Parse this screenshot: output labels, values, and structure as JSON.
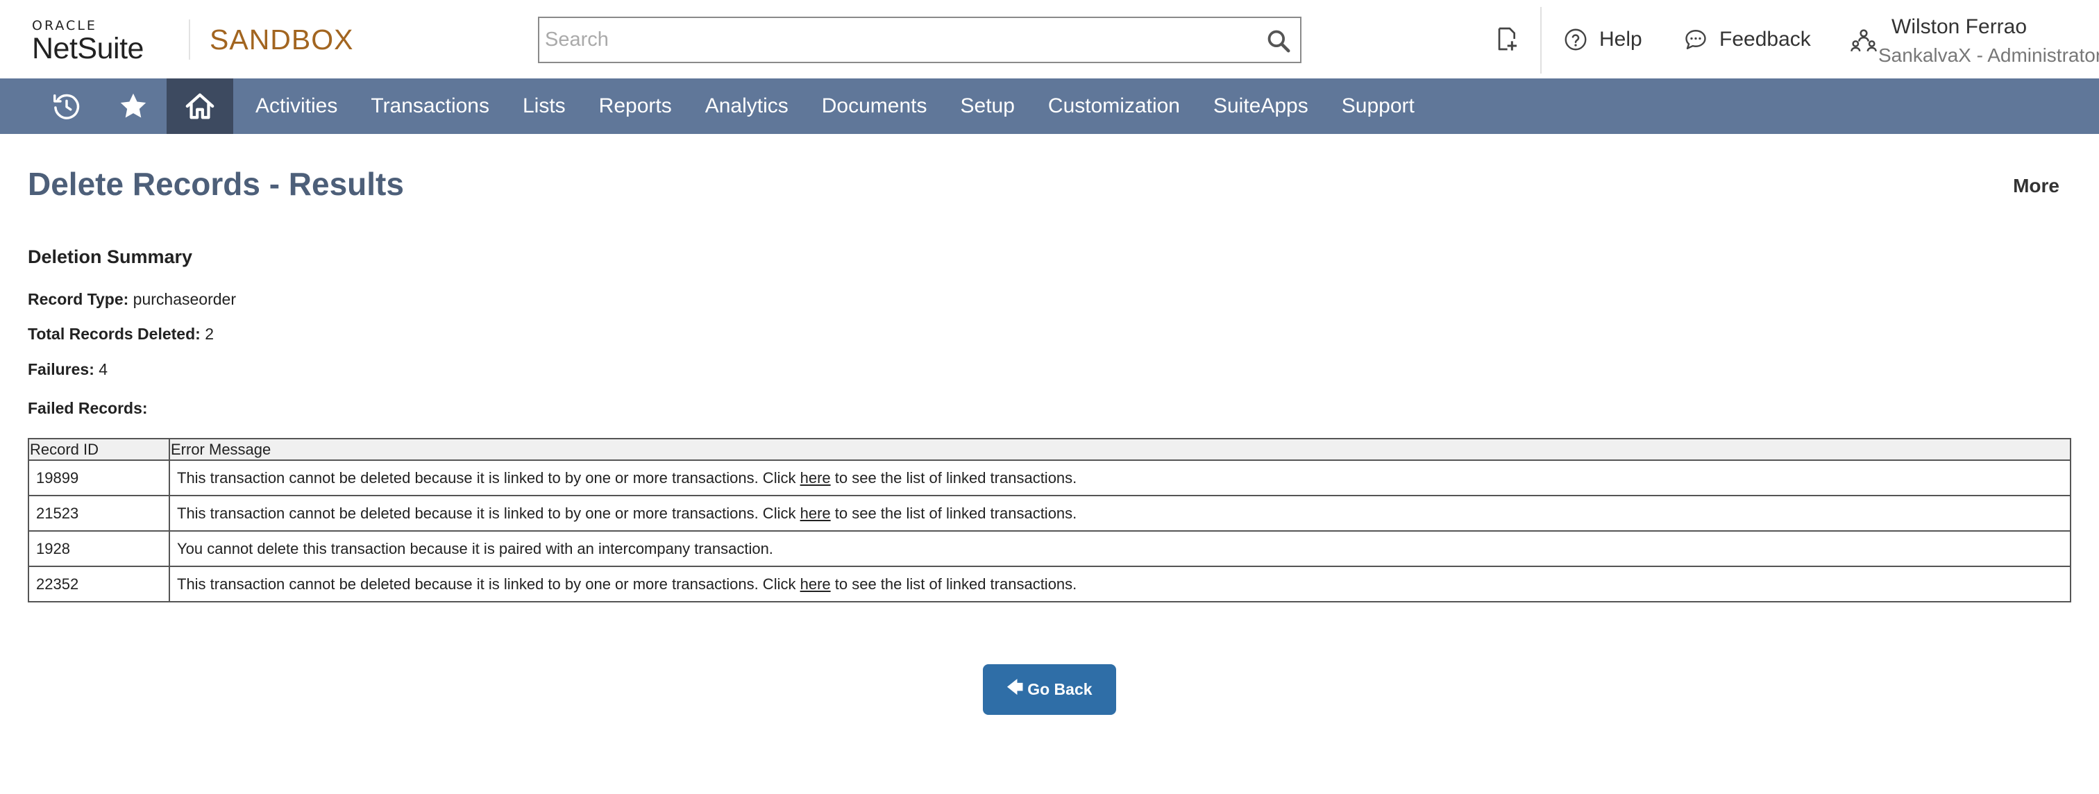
{
  "header": {
    "logo_top": "ORACLE",
    "logo_bottom": "NetSuite",
    "environment": "SANDBOX",
    "search_placeholder": "Search",
    "help_label": "Help",
    "feedback_label": "Feedback",
    "user_name": "Wilston Ferrao",
    "user_role": "SankalvaX - Administrator"
  },
  "nav": {
    "items": [
      "Activities",
      "Transactions",
      "Lists",
      "Reports",
      "Analytics",
      "Documents",
      "Setup",
      "Customization",
      "SuiteApps",
      "Support"
    ]
  },
  "page": {
    "title": "Delete Records - Results",
    "more_label": "More",
    "summary_title": "Deletion Summary",
    "record_type_label": "Record Type:",
    "record_type_value": "purchaseorder",
    "total_deleted_label": "Total Records Deleted:",
    "total_deleted_value": "2",
    "failures_label": "Failures:",
    "failures_value": "4",
    "failed_records_label": "Failed Records:"
  },
  "table": {
    "headers": [
      "Record ID",
      "Error Message"
    ],
    "rows": [
      {
        "id": "19899",
        "pre": "This transaction cannot be deleted because it is linked to by one or more transactions. Click ",
        "link": "here",
        "post": " to see the list of linked transactions."
      },
      {
        "id": "21523",
        "pre": "This transaction cannot be deleted because it is linked to by one or more transactions. Click ",
        "link": "here",
        "post": " to see the list of linked transactions."
      },
      {
        "id": "1928",
        "pre": "You cannot delete this transaction because it is paired with an intercompany transaction.",
        "link": "",
        "post": ""
      },
      {
        "id": "22352",
        "pre": "This transaction cannot be deleted because it is linked to by one or more transactions. Click ",
        "link": "here",
        "post": " to see the list of linked transactions."
      }
    ]
  },
  "actions": {
    "go_back_arrow": "🡄",
    "go_back_label": "Go Back"
  },
  "icons": {
    "create": "create-record-icon",
    "help": "help-circle-icon",
    "feedback": "chat-bubble-icon",
    "role": "role-switch-icon",
    "recent": "recent-history-icon",
    "favorites": "star-icon",
    "home": "home-icon"
  },
  "colors": {
    "nav_bg": "#607799",
    "nav_active": "#3d4a60",
    "title": "#4d5f79",
    "environment": "#a26520",
    "button": "#2f6ea7"
  }
}
